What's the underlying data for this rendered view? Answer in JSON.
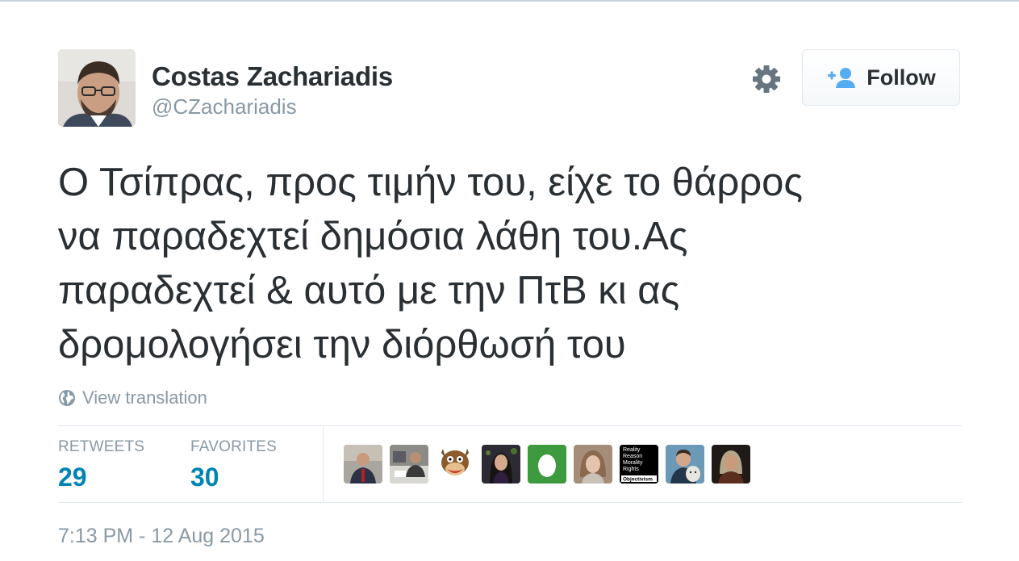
{
  "profile": {
    "name": "Costas Zachariadis",
    "handle": "@CZachariadis",
    "follow_label": "Follow"
  },
  "tweet": {
    "lines": [
      "Ο Τσίπρας, προς τιμήν του, είχε το θάρρος",
      "να παραδεχτεί δημόσια λάθη του.Ας",
      "παραδεχτεί & αυτό με την ΠτΒ κι ας",
      "δρομολογήσει την διόρθωσή του"
    ],
    "translate_label": "View translation",
    "timestamp": "7:13 PM - 12 Aug 2015"
  },
  "stats": {
    "retweets_label": "RETWEETS",
    "retweets": "29",
    "favorites_label": "FAVORITES",
    "favorites": "30"
  },
  "favoriters": {
    "objectivism_avatar_text": [
      "Reality",
      "Reason",
      "Morality",
      "Rights",
      "Objectivism"
    ]
  },
  "colors": {
    "link_blue": "#0084b4",
    "text_dark": "#292f33",
    "text_muted": "#8899a6",
    "border": "#e1e8ed",
    "follow_icon": "#55acee",
    "egg_green": "#3e9a3f"
  }
}
